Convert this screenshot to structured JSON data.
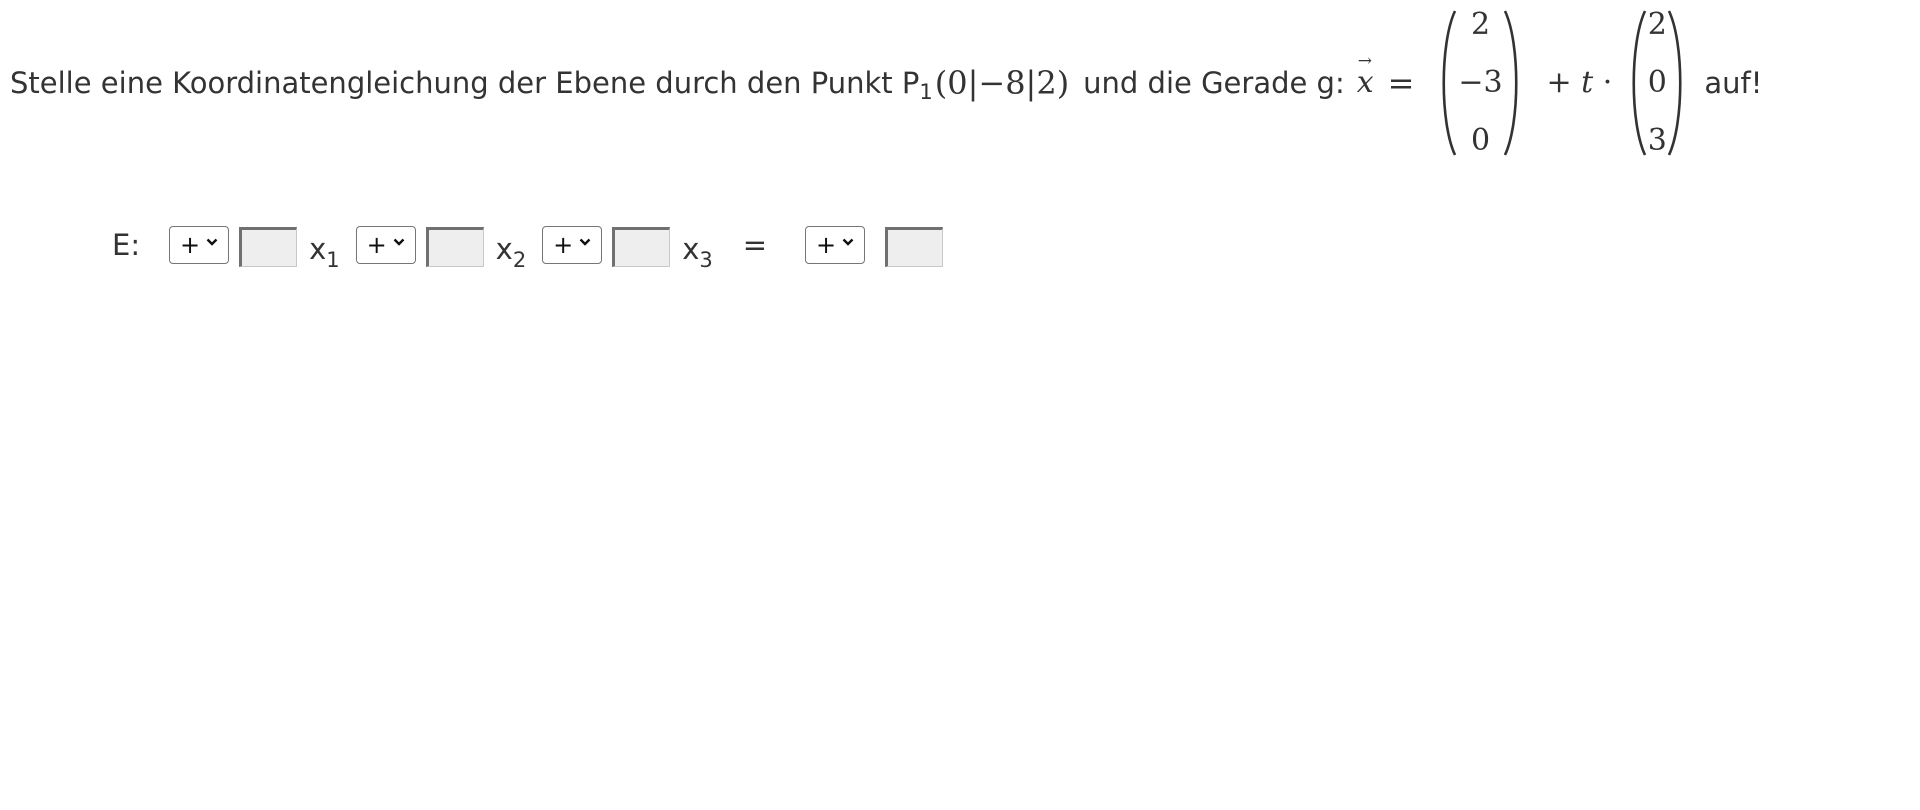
{
  "question": {
    "text_before": "Stelle eine Koordinatengleichung der Ebene durch den Punkt P",
    "point_subscript": "1",
    "point_coords": "(0|−8|2)",
    "text_middle": "und die Gerade g:",
    "vector_variable": "x",
    "vector_arrow": "→",
    "equals": "=",
    "support_vector": [
      "2",
      "−3",
      "0"
    ],
    "plus": "+",
    "parameter": "t",
    "dot": "·",
    "direction_vector": [
      "2",
      "0",
      "3"
    ],
    "text_after": "auf!"
  },
  "equation": {
    "label": "E:",
    "variables": [
      {
        "name": "x",
        "subscript": "1"
      },
      {
        "name": "x",
        "subscript": "2"
      },
      {
        "name": "x",
        "subscript": "3"
      }
    ],
    "equals": "=",
    "sign_options_selected": [
      "+",
      "+",
      "+",
      "+"
    ],
    "coefficient_values": [
      "",
      "",
      "",
      ""
    ]
  },
  "icons": {
    "dropdown": "chevron-down-icon"
  }
}
